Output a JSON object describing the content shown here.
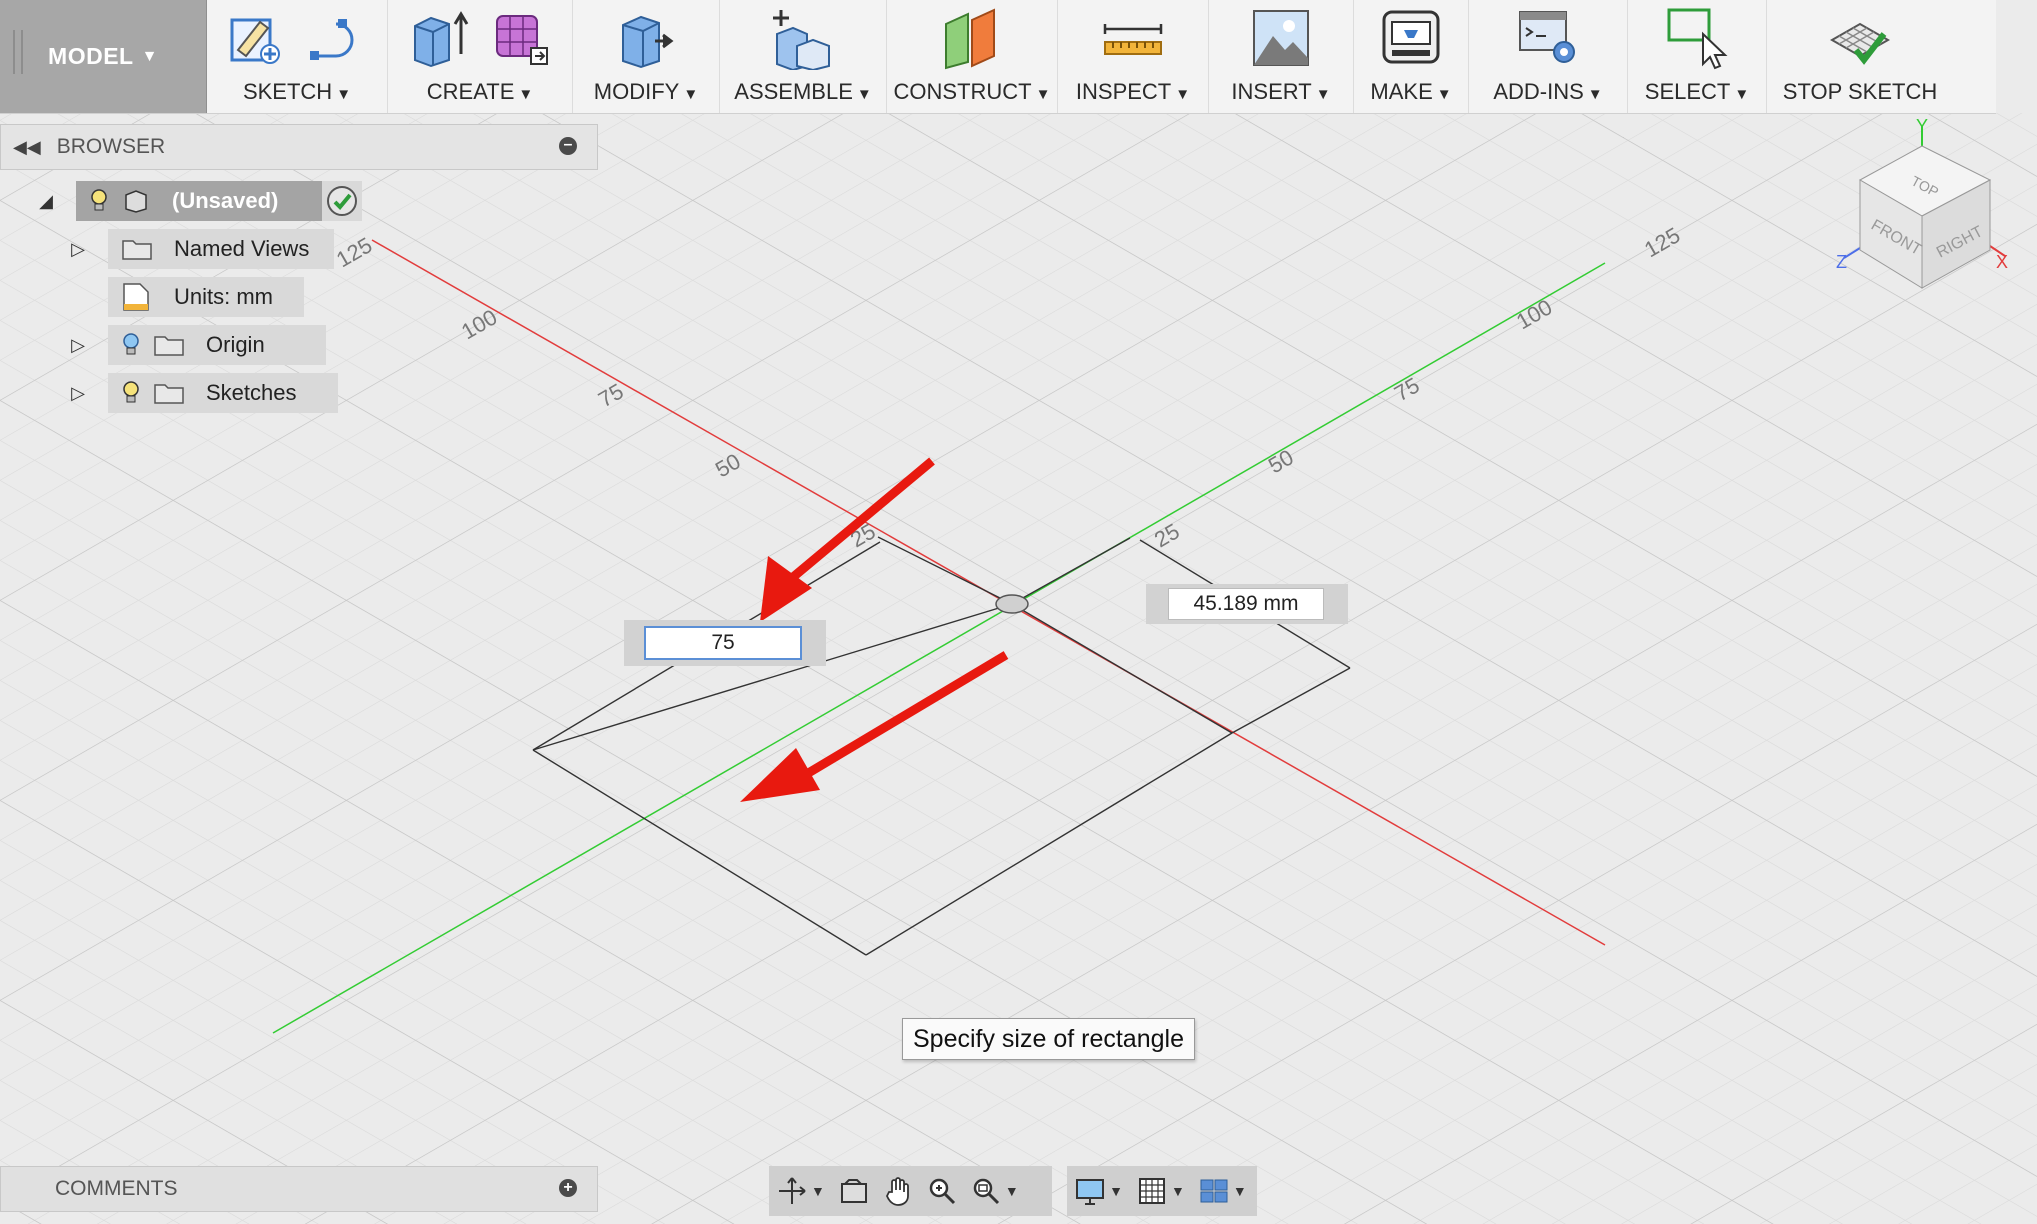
{
  "toolbar": {
    "model_label": "MODEL",
    "groups": [
      {
        "label": "SKETCH",
        "icons": [
          "create-sketch-icon",
          "sketch-arc-icon"
        ]
      },
      {
        "label": "CREATE",
        "icons": [
          "extrude-icon",
          "form-icon"
        ]
      },
      {
        "label": "MODIFY",
        "icons": [
          "press-pull-icon"
        ]
      },
      {
        "label": "ASSEMBLE",
        "icons": [
          "new-component-icon"
        ]
      },
      {
        "label": "CONSTRUCT",
        "icons": [
          "offset-plane-icon"
        ]
      },
      {
        "label": "INSPECT",
        "icons": [
          "measure-icon"
        ]
      },
      {
        "label": "INSERT",
        "icons": [
          "insert-image-icon"
        ]
      },
      {
        "label": "MAKE",
        "icons": [
          "3d-print-icon"
        ]
      },
      {
        "label": "ADD-INS",
        "icons": [
          "scripts-icon"
        ]
      },
      {
        "label": "SELECT",
        "icons": [
          "select-icon"
        ]
      },
      {
        "label": "STOP SKETCH",
        "icons": [
          "stop-sketch-icon"
        ]
      }
    ]
  },
  "browser": {
    "title": "BROWSER",
    "root": {
      "label": "(Unsaved)"
    },
    "items": [
      {
        "label": "Named Views"
      },
      {
        "label": "Units: mm"
      },
      {
        "label": "Origin"
      },
      {
        "label": "Sketches"
      }
    ]
  },
  "sketch": {
    "width_value": "75",
    "height_value": "45.189 mm",
    "tooltip": "Specify size of rectangle",
    "axis_ticks_left": [
      "125",
      "100",
      "75",
      "50",
      "25"
    ],
    "axis_ticks_right": [
      "125",
      "100",
      "75",
      "50",
      "25"
    ]
  },
  "viewcube": {
    "top": "TOP",
    "front": "FRONT",
    "right": "RIGHT",
    "axis_x": "X",
    "axis_y": "Y",
    "axis_z": "Z"
  },
  "comments": {
    "title": "COMMENTS"
  },
  "colors": {
    "x_axis": "#e23c3c",
    "y_axis": "#33cc33",
    "arrow": "#e8190f"
  }
}
